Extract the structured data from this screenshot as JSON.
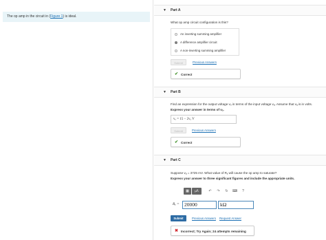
{
  "problem": {
    "prefix": "The op amp in the circuit in (",
    "figure_link": "Figure 1",
    "suffix": ") is ideal."
  },
  "partA": {
    "arrow": "▼",
    "title": "Part A",
    "question": "What op amp circuit configuration is this?",
    "choices": [
      {
        "label": "An inverting summing amplifier",
        "selected": false
      },
      {
        "label": "A difference amplifier circuit",
        "selected": true
      },
      {
        "label": "A non-inverting summing amplifier",
        "selected": false
      }
    ],
    "submit_label": "Submit",
    "previous_answers": "Previous Answers",
    "feedback_icon": "✔",
    "feedback": "Correct"
  },
  "partB": {
    "arrow": "▼",
    "title": "Part B",
    "question": "Find an expression for the output voltage vₒ in terms of the input voltage vₐ. Assume that vₐ is in volts.",
    "instruction": "Express your answer in terms of vₐ.",
    "answer": "vₒ = 15 − 2vₐ  V",
    "submit_label": "Submit",
    "previous_answers": "Previous Answers",
    "feedback_icon": "✔",
    "feedback": "Correct"
  },
  "partC": {
    "arrow": "▼",
    "title": "Part C",
    "question": "Suppose vₐ = 3725 mV. What value of Rᵧ will cause the op amp to saturate?",
    "instruction": "Express your answer to three significant figures and include the appropriate units.",
    "toolbar": {
      "templates_icon": "▦",
      "units_label": "μÅ",
      "undo_icon": "↶",
      "redo_icon": "↷",
      "reset_icon": "↻",
      "keyboard_icon": "⌨",
      "help_icon": "?"
    },
    "var_label": "Rᵧ =",
    "value": "20000",
    "units": "kΩ",
    "submit_label": "Submit",
    "previous_answers": "Previous Answers",
    "request_answer": "Request Answer",
    "feedback_icon": "✖",
    "feedback": "Incorrect; Try Again; 24 attempts remaining"
  }
}
